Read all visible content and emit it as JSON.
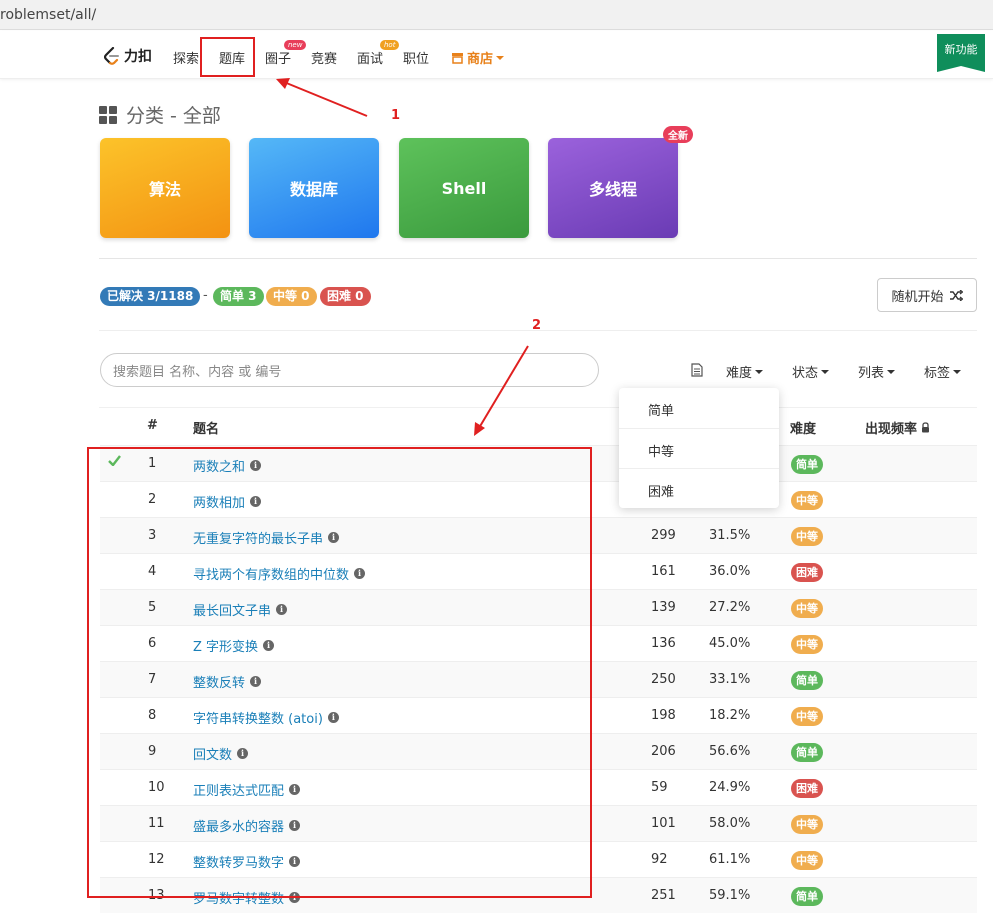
{
  "browser": {
    "url": "roblemset/all/"
  },
  "nav": {
    "logo_text": "力扣",
    "items": [
      "探索",
      "题库",
      "圈子",
      "竞赛",
      "面试",
      "职位"
    ],
    "badges": {
      "circle": "new",
      "interview": "hot"
    },
    "shop": "商店",
    "new_feature": "新功能"
  },
  "annotations": {
    "one": "1",
    "two": "2"
  },
  "section": {
    "title": "分类 - 全部"
  },
  "categories": [
    {
      "label": "算法",
      "color": "#f6a21c"
    },
    {
      "label": "数据库",
      "color": "#2f8ef0"
    },
    {
      "label": "Shell",
      "color": "#4aa84a"
    },
    {
      "label": "多线程",
      "color": "#7e4bc5"
    }
  ],
  "category_new_badge": "全新",
  "stats": {
    "solved": "已解决 3/1188",
    "sep": "-",
    "easy": "简单 3",
    "medium": "中等 0",
    "hard": "困难 0"
  },
  "random_button": "随机开始",
  "search": {
    "placeholder": "搜索题目 名称、内容 或 编号"
  },
  "filters": [
    "难度",
    "状态",
    "列表",
    "标签"
  ],
  "table": {
    "headers": {
      "id": "#",
      "title": "题名",
      "difficulty": "难度",
      "frequency": "出现频率"
    },
    "rows": [
      {
        "id": "1",
        "title": "两数之和",
        "solutions": "",
        "rate": "",
        "difficulty": "简单",
        "solved": true
      },
      {
        "id": "2",
        "title": "两数相加",
        "solutions": "",
        "rate": "",
        "difficulty": "中等",
        "solved": false
      },
      {
        "id": "3",
        "title": "无重复字符的最长子串",
        "solutions": "299",
        "rate": "31.5%",
        "difficulty": "中等",
        "solved": false
      },
      {
        "id": "4",
        "title": "寻找两个有序数组的中位数",
        "solutions": "161",
        "rate": "36.0%",
        "difficulty": "困难",
        "solved": false
      },
      {
        "id": "5",
        "title": "最长回文子串",
        "solutions": "139",
        "rate": "27.2%",
        "difficulty": "中等",
        "solved": false
      },
      {
        "id": "6",
        "title": "Z 字形变换",
        "solutions": "136",
        "rate": "45.0%",
        "difficulty": "中等",
        "solved": false
      },
      {
        "id": "7",
        "title": "整数反转",
        "solutions": "250",
        "rate": "33.1%",
        "difficulty": "简单",
        "solved": false
      },
      {
        "id": "8",
        "title": "字符串转换整数 (atoi)",
        "solutions": "198",
        "rate": "18.2%",
        "difficulty": "中等",
        "solved": false
      },
      {
        "id": "9",
        "title": "回文数",
        "solutions": "206",
        "rate": "56.6%",
        "difficulty": "简单",
        "solved": false
      },
      {
        "id": "10",
        "title": "正则表达式匹配",
        "solutions": "59",
        "rate": "24.9%",
        "difficulty": "困难",
        "solved": false
      },
      {
        "id": "11",
        "title": "盛最多水的容器",
        "solutions": "101",
        "rate": "58.0%",
        "difficulty": "中等",
        "solved": false
      },
      {
        "id": "12",
        "title": "整数转罗马数字",
        "solutions": "92",
        "rate": "61.1%",
        "difficulty": "中等",
        "solved": false
      },
      {
        "id": "13",
        "title": "罗马数字转整数",
        "solutions": "251",
        "rate": "59.1%",
        "difficulty": "简单",
        "solved": false
      }
    ]
  },
  "dropdown": {
    "options": [
      "简单",
      "中等",
      "困难"
    ]
  },
  "colors": {
    "easy": "#5cb85c",
    "medium": "#f0ad4e",
    "hard": "#d9534f",
    "solved_badge": "#337ab7",
    "annotation": "#e02020"
  }
}
